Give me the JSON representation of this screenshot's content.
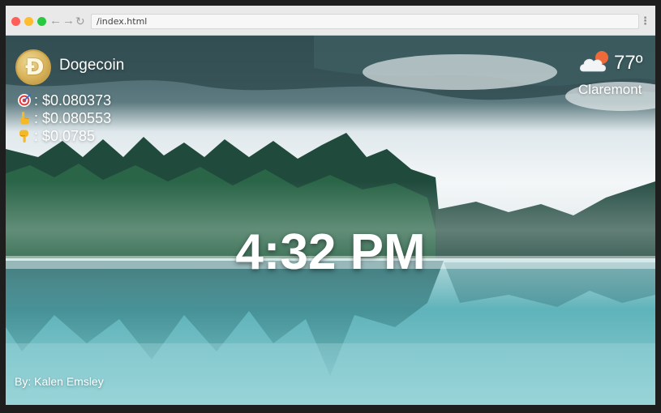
{
  "browser": {
    "url": "/index.html",
    "back_glyph": "←",
    "forward_glyph": "→",
    "reload_glyph": "↻",
    "menu_glyph": "⋮"
  },
  "crypto": {
    "logo_letter": "Ð",
    "name": "Dogecoin",
    "current_icon": "target-emoji-icon",
    "current": ": $0.080373",
    "high_icon": "hand-pointing-up-icon",
    "high": ": $0.080553",
    "low_icon": "hand-pointing-down-icon",
    "low": ": $0.0785"
  },
  "weather": {
    "icon": "partly-cloudy-icon",
    "temperature": "77º",
    "city": "Claremont"
  },
  "time": {
    "display": "4:32 PM"
  },
  "footer": {
    "credit": "By: Kalen Emsley"
  },
  "colors": {
    "accent_sun": "#ef6a3a",
    "text": "#ffffff"
  }
}
